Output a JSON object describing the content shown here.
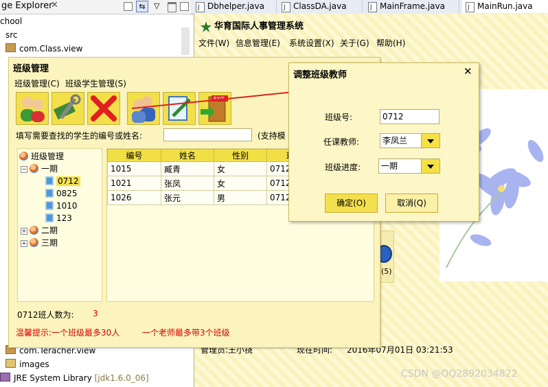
{
  "eclipse": {
    "view_title": "ge Explorer",
    "tree": [
      "chool",
      "src",
      "com.Class.view",
      "com.Teracher.view",
      "images",
      "JRE System Library"
    ],
    "jdk_label": "[jdk1.6.0_06]",
    "tabs": [
      "Dbhelper.java",
      "ClassDA.java",
      "MainFrame.java",
      "MainRun.java"
    ]
  },
  "main_frame": {
    "title": "华育国际人事管理系统",
    "menu": [
      "文件(W)",
      "信息管理(E)",
      "系统设置(X)",
      "关于(G)",
      "帮助(H)"
    ],
    "partial_label": "(5)",
    "operator": "管理员:王小挠",
    "time_label": "现在时间:",
    "time_value": "2016年07月01日 03:21:53"
  },
  "class_dialog": {
    "title": "班级管理",
    "menu": [
      "班级管理(C)",
      "班级学生管理(S)"
    ],
    "toolbar_icons": [
      "users-icon",
      "settings-tool-icon",
      "delete-x-icon",
      "people-icon",
      "edit-document-icon",
      "exit-door-icon"
    ],
    "exit_sign": "EXIT",
    "search_label": "填写需要查找的学生的编号或姓名:",
    "search_value": "",
    "search_hint": "(支持模",
    "tree": {
      "root": "班级管理",
      "groups": [
        {
          "label": "一期",
          "expanded": true,
          "items": [
            "0712",
            "0825",
            "1010",
            "123"
          ]
        },
        {
          "label": "二期",
          "expanded": false,
          "items": []
        },
        {
          "label": "三期",
          "expanded": false,
          "items": []
        }
      ],
      "selected": "0712"
    },
    "table": {
      "headers": [
        "编号",
        "姓名",
        "性别",
        "班"
      ],
      "rows": [
        [
          "1015",
          "臧青",
          "女",
          "0712"
        ],
        [
          "1021",
          "张凤",
          "女",
          "0712"
        ],
        [
          "1026",
          "张元",
          "男",
          "0712"
        ]
      ]
    },
    "count_label": "0712班人数为:",
    "count_value": "3",
    "tip1": "温馨提示:一个班级最多30人",
    "tip2": "一个老师最多带3个班级"
  },
  "teacher_dialog": {
    "title": "调整班级教师",
    "close": "✕",
    "class_label": "班级号:",
    "class_value": "0712",
    "teacher_label": "任课教师:",
    "teacher_value": "李凤兰",
    "progress_label": "班级进度:",
    "progress_value": "一期",
    "ok": "确定(O)",
    "cancel": "取消(Q)"
  },
  "watermark": "CSDN @QQ2892034822",
  "colors": {
    "accent": "#f4e04e",
    "panel": "#fbf4be",
    "tip_red": "#d40000",
    "count_red": "#d40000"
  }
}
